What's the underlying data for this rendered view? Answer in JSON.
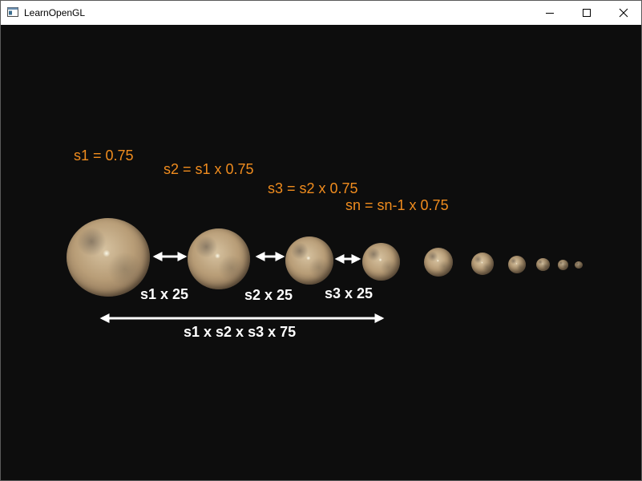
{
  "window": {
    "title": "LearnOpenGL",
    "controls": {
      "minimize": "minimize-icon",
      "maximize": "maximize-icon",
      "close": "close-icon"
    }
  },
  "annotations": {
    "formulas": [
      "s1 = 0.75",
      "s2 = s1 x 0.75",
      "s3 = s2 x 0.75",
      "sn = sn-1 x 0.75"
    ],
    "distances": [
      "s1 x 25",
      "s2 x 25",
      "s3 x 25"
    ],
    "total": "s1 x s2 x s3 x 75"
  },
  "colors": {
    "background": "#0d0d0d",
    "formula_text": "#f08c1e",
    "distance_text": "#ffffff"
  }
}
